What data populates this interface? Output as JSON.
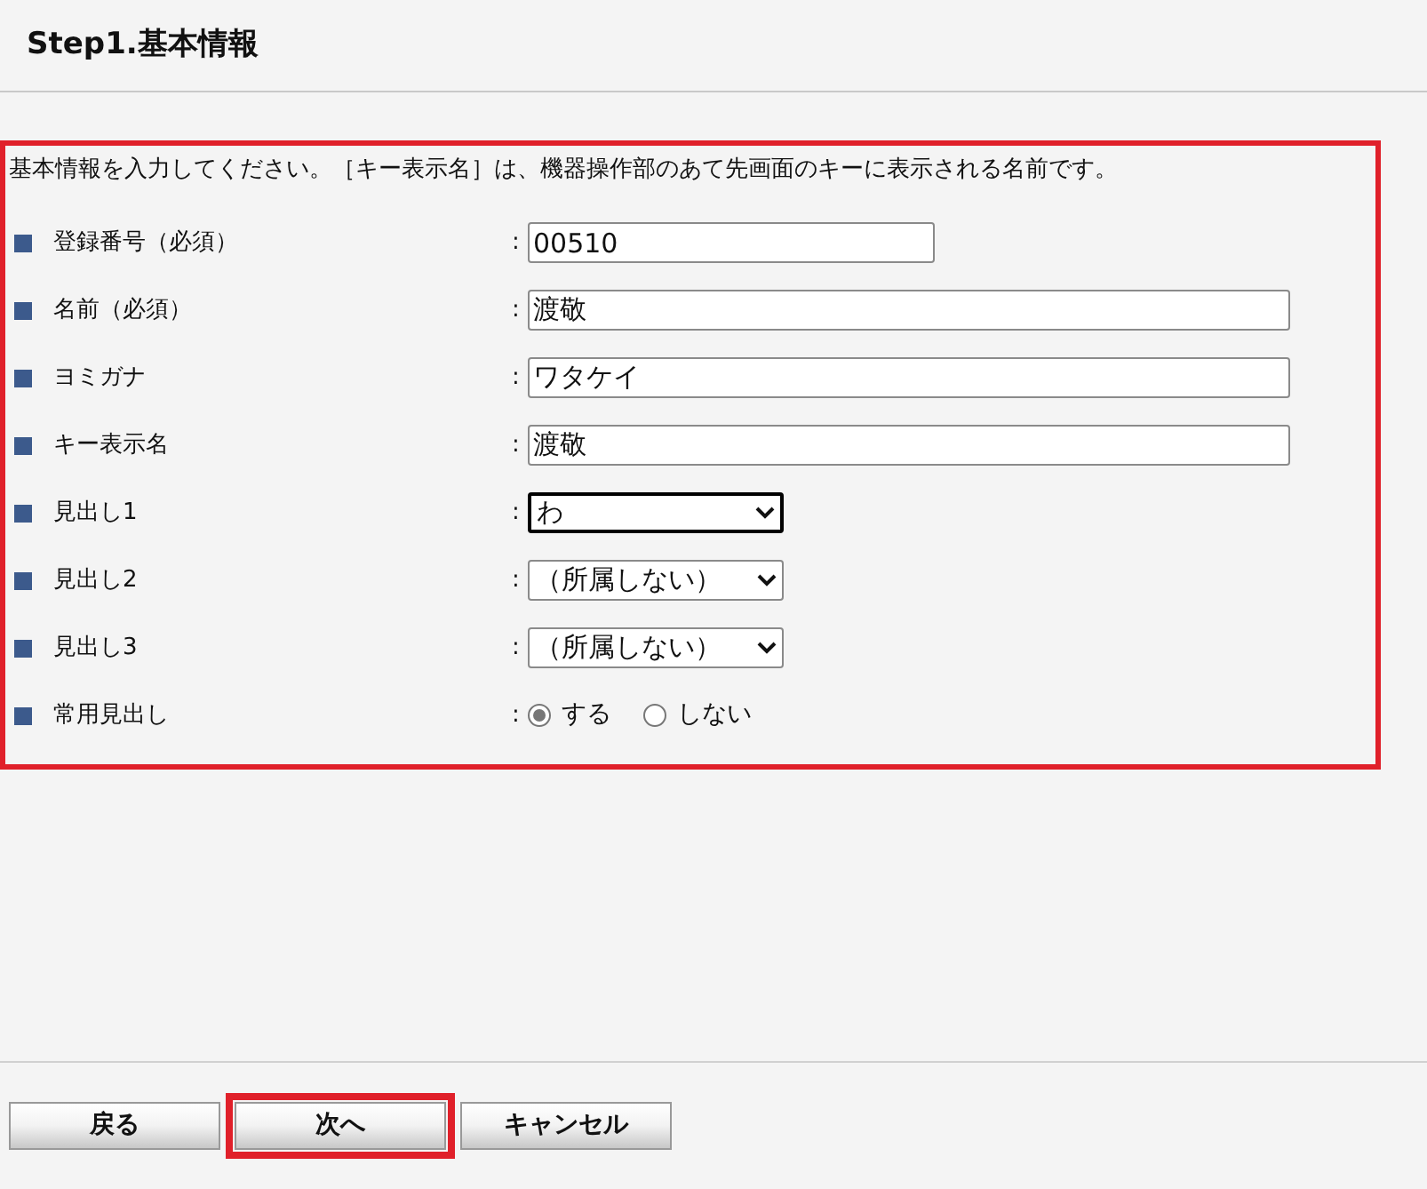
{
  "title": "Step1.基本情報",
  "form": {
    "highlighted": true,
    "intro": "基本情報を入力してください。［キー表示名］は、機器操作部のあて先画面のキーに表示される名前です。",
    "fields": [
      {
        "kind": "text",
        "label": "登録番号（必須）",
        "separator": ":",
        "value": "00510",
        "wide": false
      },
      {
        "kind": "text",
        "label": "名前（必須）",
        "separator": ":",
        "value": "渡敬",
        "wide": true
      },
      {
        "kind": "text",
        "label": "ヨミガナ",
        "separator": ":",
        "value": "ワタケイ",
        "wide": true
      },
      {
        "kind": "text",
        "label": "キー表示名",
        "separator": ":",
        "value": "渡敬",
        "wide": true
      },
      {
        "kind": "select",
        "label": "見出し1",
        "separator": ":",
        "value": "わ",
        "focused": true
      },
      {
        "kind": "select",
        "label": "見出し2",
        "separator": ":",
        "value": "（所属しない）",
        "focused": false
      },
      {
        "kind": "select",
        "label": "見出し3",
        "separator": ":",
        "value": "（所属しない）",
        "focused": false
      },
      {
        "kind": "radio",
        "label": "常用見出し",
        "separator": ":",
        "options": [
          {
            "label": "する",
            "selected": true
          },
          {
            "label": "しない",
            "selected": false
          }
        ]
      }
    ]
  },
  "buttons": [
    {
      "label": "戻る",
      "highlighted": false
    },
    {
      "label": "次へ",
      "highlighted": true
    },
    {
      "label": "キャンセル",
      "highlighted": false
    }
  ]
}
